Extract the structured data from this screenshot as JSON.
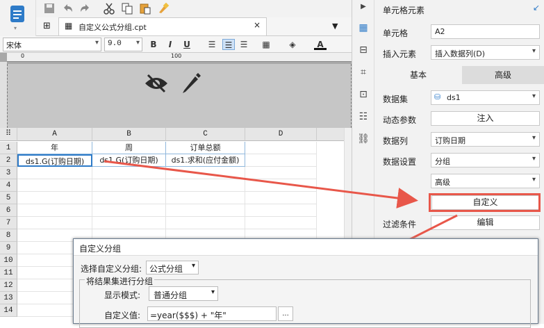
{
  "tabs": {
    "file": "自定义公式分组.cpt"
  },
  "format": {
    "font": "宋体",
    "size": "9.0",
    "bold": "B",
    "italic": "I",
    "underline": "U"
  },
  "ruler": {
    "zero": "0",
    "hundred": "100"
  },
  "grid": {
    "cols": [
      "A",
      "B",
      "C",
      "D"
    ],
    "rows": [
      "1",
      "2",
      "3",
      "4",
      "5",
      "6",
      "7",
      "8",
      "9",
      "10",
      "11",
      "12",
      "13",
      "14"
    ],
    "row1": [
      "年",
      "周",
      "订单总额"
    ],
    "row2": [
      "ds1.G(订购日期)",
      "ds1.G(订购日期)",
      "ds1.求和(应付金额)"
    ]
  },
  "panel": {
    "title": "单元格元素",
    "cell_label": "单元格",
    "cell_value": "A2",
    "insert_label": "插入元素",
    "insert_value": "插入数据列(D)",
    "tab_basic": "基本",
    "tab_adv": "高级",
    "dataset_label": "数据集",
    "dataset_value": "ds1",
    "param_label": "动态参数",
    "param_btn": "注入",
    "col_label": "数据列",
    "col_value": "订购日期",
    "setting_label": "数据设置",
    "setting_value": "分组",
    "adv_value": "高级",
    "custom_btn": "自定义",
    "filter_label": "过滤条件",
    "filter_btn": "编辑"
  },
  "dialog": {
    "title": "自定义分组",
    "select_label": "选择自定义分组:",
    "select_value": "公式分组",
    "group_title": "将结果集进行分组",
    "mode_label": "显示模式:",
    "mode_value": "普通分组",
    "value_label": "自定义值:",
    "value_text": "=year($$$) + \"年\"",
    "dots": "..."
  },
  "colors": {
    "accent": "#2e7bc8",
    "arrow": "#e8574a"
  }
}
